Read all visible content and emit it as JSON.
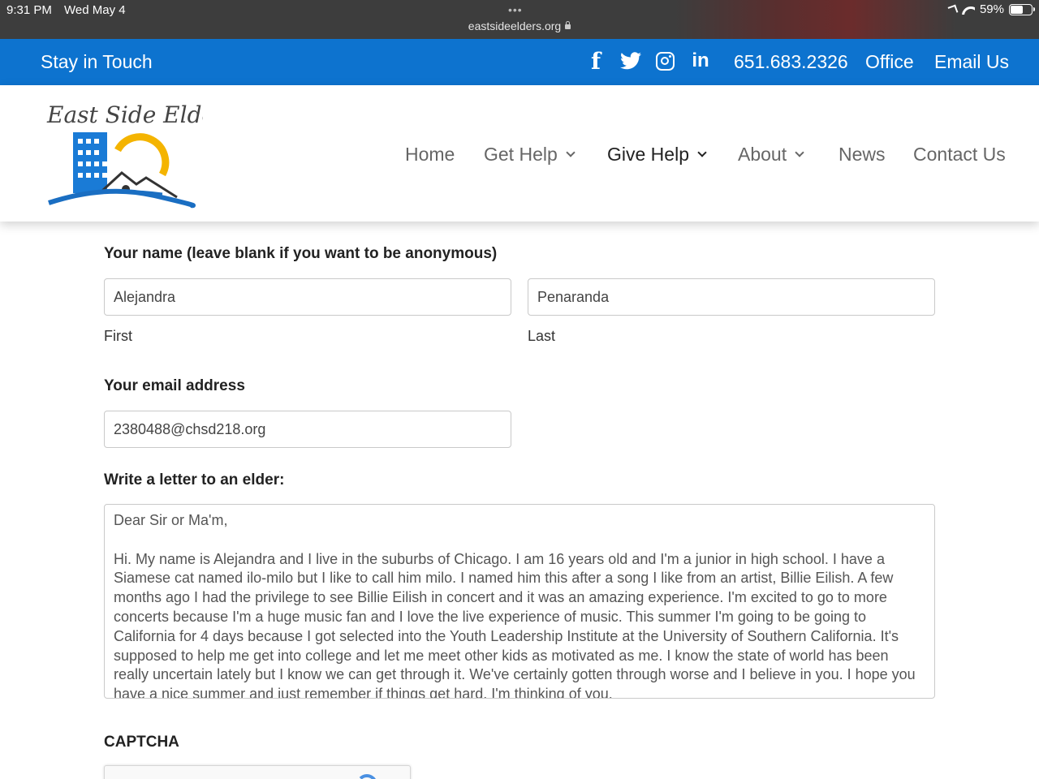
{
  "status_bar": {
    "time": "9:31 PM",
    "date": "Wed May 4",
    "dots": "•••",
    "url": "eastsideelders.org",
    "battery": "59%",
    "battery_level": 0.59
  },
  "topbar": {
    "title": "Stay in Touch",
    "social_icons": [
      "facebook-icon",
      "twitter-icon",
      "instagram-icon",
      "linkedin-icon"
    ],
    "facebook_glyph": "f",
    "linkedin_glyph": "in",
    "phone": "651.683.2326",
    "office": "Office",
    "email": "Email Us",
    "background": "#0d73cf"
  },
  "logo": {
    "text": "East Side Elders"
  },
  "nav": {
    "items": [
      {
        "label": "Home"
      },
      {
        "label": "Get Help"
      },
      {
        "label": "Give Help"
      },
      {
        "label": "About"
      },
      {
        "label": "News"
      },
      {
        "label": "Contact Us"
      }
    ]
  },
  "form": {
    "name_label": "Your name (leave blank if you want to be anonymous)",
    "first_value": "Alejandra",
    "first_label": "First",
    "last_value": "Penaranda",
    "last_label": "Last",
    "email_label": "Your email address",
    "email_value": "2380488@chsd218.org",
    "letter_label": "Write a letter to an elder:",
    "letter_value": "Dear Sir or Ma'm,\n\nHi. My name is Alejandra and I live in the suburbs of Chicago. I am 16 years old and I'm a junior in high school. I have a Siamese cat named ilo-milo but I like to call him milo. I named him this after a song I like from an artist, Billie Eilish. A few months ago I had the privilege to see Billie Eilish in concert and it was an amazing experience. I'm excited to go to more concerts because I'm a huge music fan and I love the live experience of music. This summer I'm going to be going to California for 4 days because I got selected into the Youth Leadership Institute at the University of Southern California. It's supposed to help me get into college and let me meet other kids as motivated as me. I know the state of world has been really uncertain lately but I know we can get through it. We've certainly gotten through worse and I believe in you. I hope you have a nice summer and just remember if things get hard, I'm thinking of you.",
    "captcha_label": "CAPTCHA"
  }
}
